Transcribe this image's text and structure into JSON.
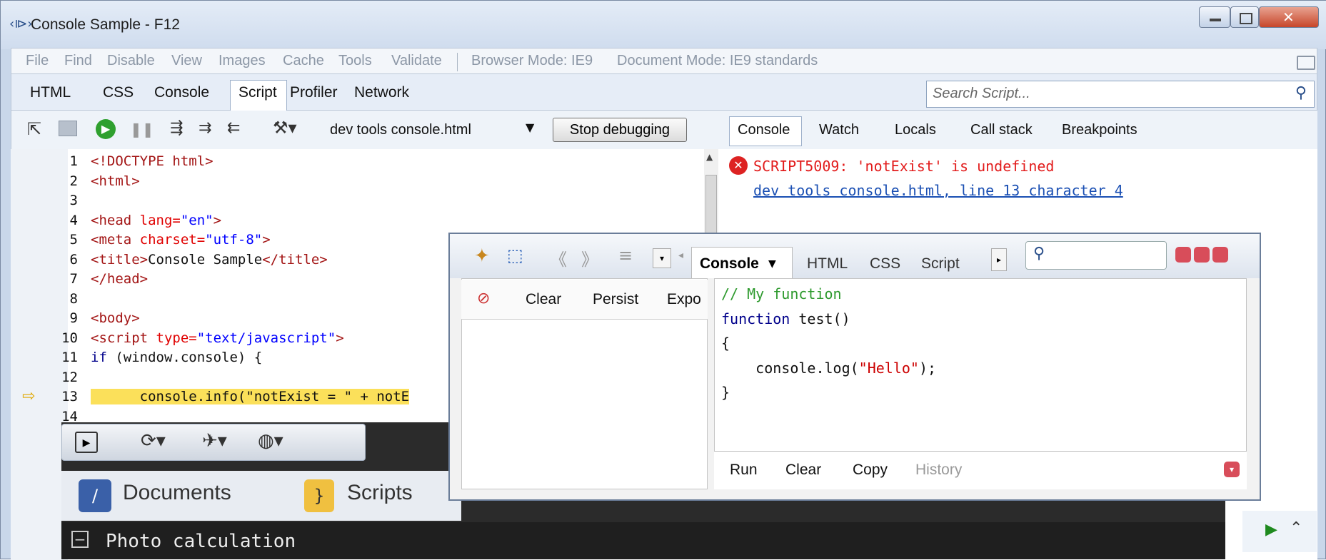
{
  "window": {
    "title": "Console Sample - F12"
  },
  "menubar": {
    "items": [
      "File",
      "Find",
      "Disable",
      "View",
      "Images",
      "Cache",
      "Tools",
      "Validate"
    ],
    "browser_mode": "Browser Mode: IE9",
    "document_mode": "Document Mode: IE9 standards"
  },
  "tabs": [
    "HTML",
    "CSS",
    "Console",
    "Script",
    "Profiler",
    "Network"
  ],
  "search": {
    "placeholder": "Search Script..."
  },
  "toolbar": {
    "file": "dev tools console.html",
    "stop_label": "Stop debugging"
  },
  "right_tabs": [
    "Console",
    "Watch",
    "Locals",
    "Call stack",
    "Breakpoints"
  ],
  "console_error": {
    "message": "SCRIPT5009: 'notExist' is undefined",
    "link": "dev tools console.html, line 13 character 4"
  },
  "code_lines": [
    {
      "n": "1",
      "parts": [
        [
          "tag",
          "<!DOCTYPE html>"
        ]
      ]
    },
    {
      "n": "2",
      "parts": [
        [
          "tag",
          "<html>"
        ]
      ]
    },
    {
      "n": "3",
      "parts": []
    },
    {
      "n": "4",
      "parts": [
        [
          "tag",
          "<head "
        ],
        [
          "attr",
          "lang="
        ],
        [
          "str",
          "\"en\""
        ],
        [
          "tag",
          ">"
        ]
      ]
    },
    {
      "n": "5",
      "parts": [
        [
          "tag",
          "<meta "
        ],
        [
          "attr",
          "charset="
        ],
        [
          "str",
          "\"utf-8\""
        ],
        [
          "tag",
          ">"
        ]
      ]
    },
    {
      "n": "6",
      "parts": [
        [
          "tag",
          "<title>"
        ],
        [
          "plain",
          "Console Sample"
        ],
        [
          "tag",
          "</title>"
        ]
      ]
    },
    {
      "n": "7",
      "parts": [
        [
          "tag",
          "</head>"
        ]
      ]
    },
    {
      "n": "8",
      "parts": []
    },
    {
      "n": "9",
      "parts": [
        [
          "tag",
          "<body>"
        ]
      ]
    },
    {
      "n": "10",
      "parts": [
        [
          "tag",
          "<script "
        ],
        [
          "attr",
          "type="
        ],
        [
          "str",
          "\"text/javascript\""
        ],
        [
          "tag",
          ">"
        ]
      ]
    },
    {
      "n": "11",
      "parts": [
        [
          "blu",
          "if "
        ],
        [
          "plain",
          "(window.console) {"
        ]
      ]
    },
    {
      "n": "12",
      "parts": []
    },
    {
      "n": "13",
      "parts": [
        [
          "hl",
          "      console.info(\"notExist = \" + notE"
        ]
      ]
    },
    {
      "n": "14",
      "parts": []
    }
  ],
  "firebug": {
    "tabs": [
      "Console",
      "HTML",
      "CSS",
      "Script"
    ],
    "left_bar": [
      "Clear",
      "Persist",
      "Expo"
    ],
    "code": [
      [
        [
          "cmt",
          "// My function"
        ]
      ],
      [
        [
          "kw",
          "function "
        ],
        [
          "plain",
          "test()"
        ]
      ],
      [
        [
          "plain",
          "{"
        ]
      ],
      [
        [
          "plain",
          "    console.log("
        ],
        [
          "s",
          "\"Hello\""
        ],
        [
          "plain",
          ");"
        ]
      ],
      [
        [
          "plain",
          "}"
        ]
      ]
    ],
    "footer": [
      "Run",
      "Clear",
      "Copy",
      "History"
    ]
  },
  "dark_panel": {
    "nav": [
      "Documents",
      "Scripts"
    ],
    "photo_title": "Photo calculation"
  },
  "colors": {
    "error": "#e21b1b",
    "link": "#1a4fb3",
    "highlight": "#fbe05a"
  }
}
